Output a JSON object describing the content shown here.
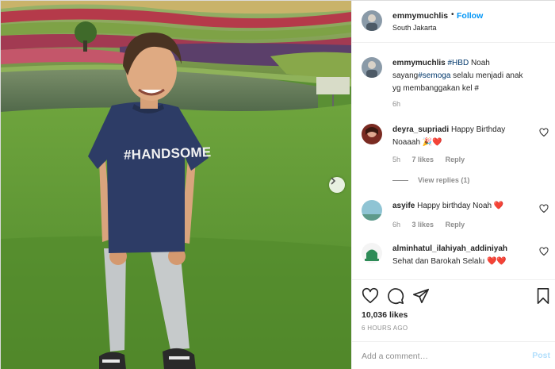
{
  "header": {
    "username": "emmymuchlis",
    "separator": "•",
    "follow_label": "Follow",
    "location": "South Jakarta"
  },
  "photo": {
    "shirt_text": "#HANDSOME",
    "next_icon": "chevron-right-icon"
  },
  "caption": {
    "username": "emmymuchlis",
    "hashtag1": "#HBD",
    "text1": " Noah sayang",
    "hashtag2": "#semoga",
    "text2": " selalu menjadi anak yg membanggakan kel #",
    "time": "6h"
  },
  "comments": [
    {
      "username": "deyra_supriadi",
      "text": "Happy Birthday Noaaah",
      "emoji": "🎉❤️",
      "time": "5h",
      "likes": "7 likes",
      "reply_label": "Reply",
      "view_replies": "View replies (1)"
    },
    {
      "username": "asyife",
      "text": "Happy birthday Noah",
      "emoji": "❤️",
      "time": "6h",
      "likes": "3 likes",
      "reply_label": "Reply"
    },
    {
      "username": "alminhatul_ilahiyah_addiniyah",
      "text": "Sehat dan Barokah Selalu",
      "emoji": "❤️❤️"
    }
  ],
  "actions": {
    "like_icon": "heart-icon",
    "comment_icon": "comment-icon",
    "share_icon": "share-icon",
    "save_icon": "bookmark-icon",
    "likes_count": "10,036 likes",
    "posted_time": "6 HOURS AGO"
  },
  "add_comment": {
    "placeholder": "Add a comment…",
    "post_label": "Post"
  },
  "colors": {
    "accent": "#0095f6",
    "heart_red": "#ed4956",
    "hashtag": "#00376b",
    "muted": "#8e8e8e"
  }
}
